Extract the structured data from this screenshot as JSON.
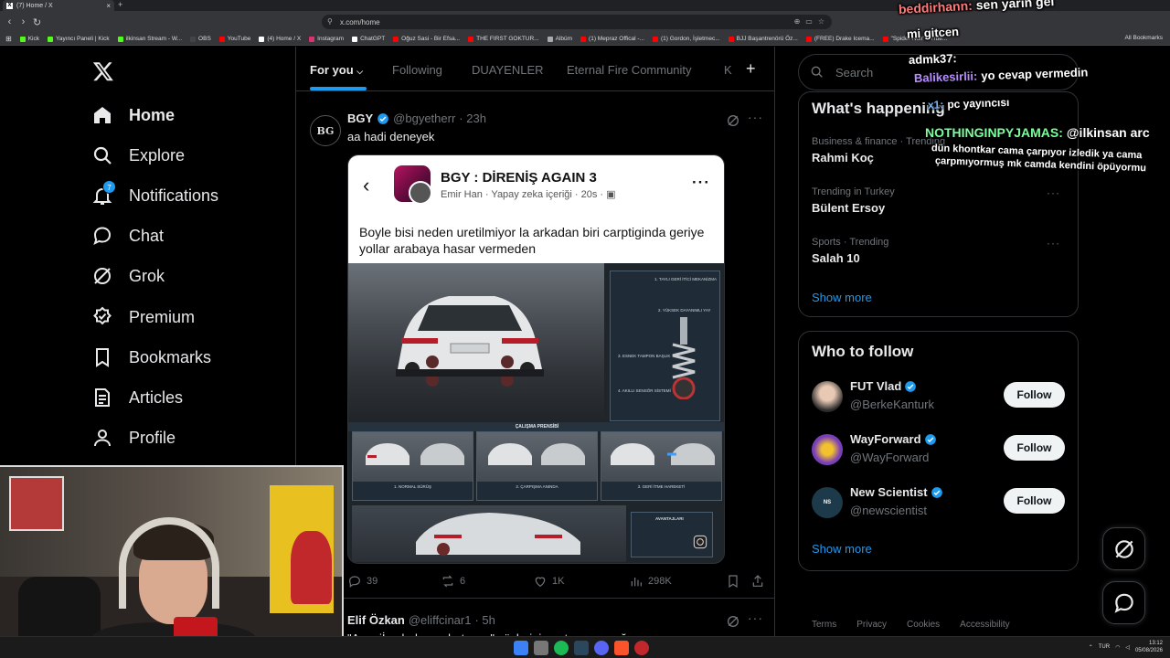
{
  "browser": {
    "tab_title": "(7) Home / X",
    "url": "x.com/home",
    "bookmarks": [
      {
        "label": "Kick",
        "color": "#53fc18"
      },
      {
        "label": "Yayıncı Paneli | Kick",
        "color": "#53fc18"
      },
      {
        "label": "ilkinsan Stream - W...",
        "color": "#53fc18"
      },
      {
        "label": "OBS",
        "color": "#444444"
      },
      {
        "label": "YouTube",
        "color": "#ff0000"
      },
      {
        "label": "(4) Home / X",
        "color": "#ffffff"
      },
      {
        "label": "Instagram",
        "color": "#e1306c"
      },
      {
        "label": "ChatGPT",
        "color": "#ffffff"
      },
      {
        "label": "Oğuz Sasi - Bir Efsa...",
        "color": "#ff0000"
      },
      {
        "label": "THE FIRST GOKTUR...",
        "color": "#ff0000"
      },
      {
        "label": "Albüm",
        "color": "#aaaaaa"
      },
      {
        "label": "(1) Mepraz Offical -...",
        "color": "#ff0000"
      },
      {
        "label": "(1) Gordon, İşletmec...",
        "color": "#ff0000"
      },
      {
        "label": "BJJ Başantrenörü Öz...",
        "color": "#ff0000"
      },
      {
        "label": "(FREE) Drake Icema...",
        "color": "#ff0000"
      },
      {
        "label": "\"Spider-Noir\" - True...",
        "color": "#ff0000"
      }
    ],
    "all_bookmarks": "All Bookmarks"
  },
  "nav": {
    "items": [
      {
        "label": "Home",
        "icon": "home-icon"
      },
      {
        "label": "Explore",
        "icon": "search-icon"
      },
      {
        "label": "Notifications",
        "icon": "bell-icon",
        "badge": "7"
      },
      {
        "label": "Chat",
        "icon": "chat-icon"
      },
      {
        "label": "Grok",
        "icon": "grok-icon"
      },
      {
        "label": "Premium",
        "icon": "premium-icon"
      },
      {
        "label": "Bookmarks",
        "icon": "bookmark-icon"
      },
      {
        "label": "Articles",
        "icon": "articles-icon"
      },
      {
        "label": "Profile",
        "icon": "profile-icon"
      }
    ]
  },
  "feed": {
    "tabs": [
      "For you",
      "Following",
      "DUAYENLER",
      "Eternal Fire Community",
      "K"
    ],
    "post": {
      "name": "BGY",
      "handle": "@bgyetherr",
      "time": "· 23h",
      "text": "aa hadi deneyek",
      "avatar_text": "BG",
      "embed": {
        "title": "BGY : DİRENİŞ AGAIN 3",
        "subtitle": "Emir Han · Yapay zeka içeriği · 20s ·",
        "body": "Boyle bisi neden uretilmiyor la arkadan biri carptiginda geriye yollar arabaya hasar vermeden",
        "diagram_labels": [
          "1. TAYLI GERİ İTİCİ MEKANİZMA",
          "2. YÜKSEK DAYANIMLI YAY",
          "3. ESNEK TAMPON BAŞLIK",
          "4. AKILLI SENSÖR SİSTEMİ"
        ],
        "caption": "ÇALIŞMA PRENSİBİ",
        "steps": [
          "1. NORMAL SÜRÜŞ",
          "2. ÇARPIŞMA ANINDA",
          "3. GERİ İTME HAREKETİ"
        ],
        "advantages_title": "AVANTAJLARI"
      },
      "stats": {
        "replies": "39",
        "reposts": "6",
        "likes": "1K",
        "views": "298K"
      }
    },
    "post2": {
      "name": "Elif Özkan",
      "handle": "@eliffcinar1",
      "time": "· 5h",
      "text": "\"Ama iİne babama batıyor..\" sözlerini unutmuyorum ğ..."
    }
  },
  "right": {
    "search_placeholder": "Search",
    "trends_title": "What's happening",
    "trends": [
      {
        "meta": "Business & finance · Trending",
        "topic": "Rahmi Koç"
      },
      {
        "meta": "Trending in Turkey",
        "topic": "Bülent Ersoy"
      },
      {
        "meta": "Sports · Trending",
        "topic": "Salah 10"
      }
    ],
    "show_more": "Show more",
    "who_title": "Who to follow",
    "follow": [
      {
        "name": "FUT Vlad",
        "handle": "@BerkeKanturk",
        "button": "Follow"
      },
      {
        "name": "WayForward",
        "handle": "@WayForward",
        "button": "Follow"
      },
      {
        "name": "New Scientist",
        "handle": "@newscientist",
        "button": "Follow"
      }
    ],
    "footer": [
      "Terms",
      "Privacy",
      "Cookies",
      "Accessibility"
    ]
  },
  "stream_chat": [
    {
      "user": "beddirhann:",
      "msg": "sen yarın gel",
      "color": "#ff7a7a"
    },
    {
      "user": "",
      "msg": "mi gitcen",
      "color": "#ffffff"
    },
    {
      "user": "admk37:",
      "msg": "",
      "color": "#ffffff"
    },
    {
      "user": "Balikesirlii:",
      "msg": "yo cevap vermedin",
      "color": "#b68cff"
    },
    {
      "user": "x1:",
      "msg": "pc yayıncısı",
      "color": "#7ab8ff"
    },
    {
      "user": "NOTHINGINPYJAMAS:",
      "msg": "@ilkinsan arc",
      "color": "#7aff9c"
    },
    {
      "user": "",
      "msg": "dün khontkar cama çarpıyor izledik ya cama",
      "color": "#ffffff"
    },
    {
      "user": "",
      "msg": "çarpmıyormuş mk camda kendini öpüyormu",
      "color": "#ffffff"
    }
  ],
  "taskbar": {
    "lang": "TUR",
    "time": "13:12",
    "date": "05/08/2026"
  }
}
